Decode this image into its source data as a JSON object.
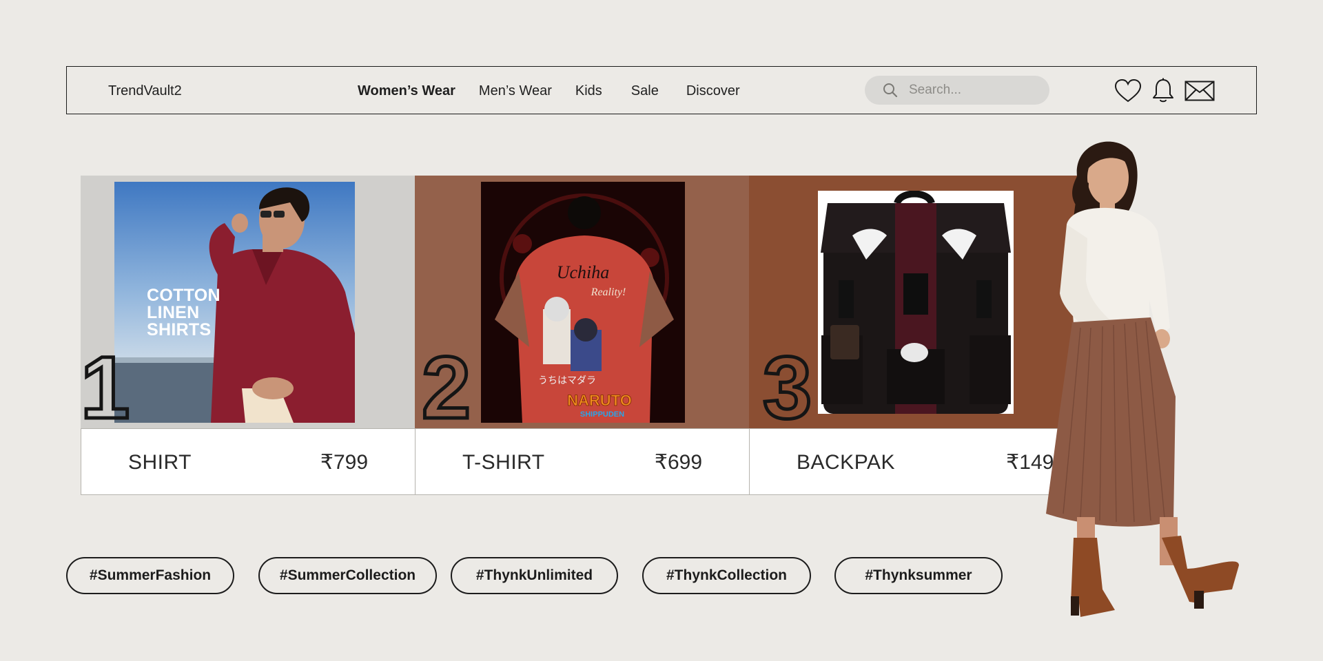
{
  "header": {
    "brand": "TrendVault2",
    "nav": [
      {
        "label": "Women’s Wear",
        "active": true
      },
      {
        "label": "Men’s Wear",
        "active": false
      },
      {
        "label": "Kids",
        "active": false
      },
      {
        "label": "Sale",
        "active": false
      },
      {
        "label": "Discover",
        "active": false
      }
    ],
    "search": {
      "placeholder": "Search...",
      "icon": "search-icon"
    },
    "icons": [
      "heart-icon",
      "bell-icon",
      "mail-icon"
    ]
  },
  "products": [
    {
      "rank": "1",
      "name": "SHIRT",
      "price": "₹799",
      "image_text": "COTTON\nLINEN\nSHIRTS",
      "bg": "#d0cfcc"
    },
    {
      "rank": "2",
      "name": "T-SHIRT",
      "price": "₹699",
      "bg": "#94614b"
    },
    {
      "rank": "3",
      "name": "BACKPAK",
      "price": "₹1499",
      "bg": "#8b4e32"
    }
  ],
  "hashtags": [
    "#SummerFashion",
    "#SummerCollection",
    "#ThynkUnlimited",
    "#ThynkCollection",
    "#Thynksummer"
  ],
  "colors": {
    "background": "#eceae6",
    "card_bg_1": "#d0cfcc",
    "card_bg_2": "#94614b",
    "card_bg_3": "#8b4e32",
    "search_bg": "#d9d8d5"
  }
}
